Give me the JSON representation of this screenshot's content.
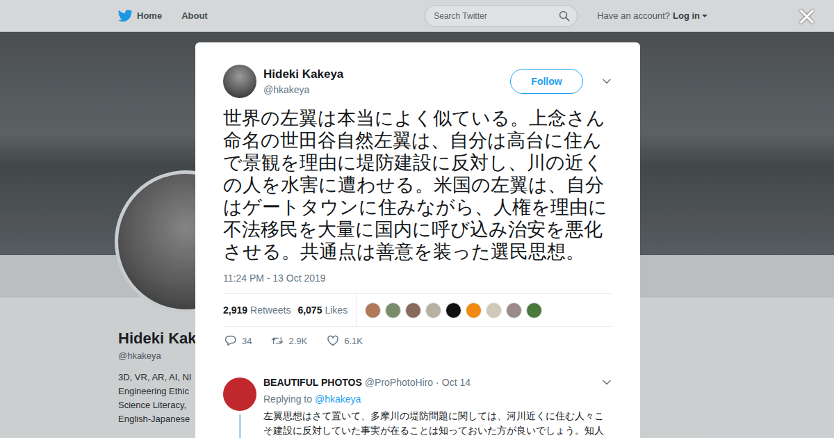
{
  "nav": {
    "items": [
      "Home",
      "About"
    ],
    "search": {
      "placeholder": "Search Twitter"
    },
    "account_prompt": "Have an account?",
    "login": "Log in"
  },
  "close": "×",
  "profile": {
    "name": "Hideki Kake",
    "handle": "@hkakeya",
    "bio_lines": [
      "3D, VR, AR, AI, NI",
      "Engineering Ethic",
      "Science Literacy,",
      "English-Japanese"
    ]
  },
  "tweet": {
    "author": "Hideki Kakeya",
    "handle": "@hkakeya",
    "follow": "Follow",
    "text": "世界の左翼は本当によく似ている。上念さん命名の世田谷自然左翼は、自分は高台に住んで景観を理由に堤防建設に反対し、川の近くの人を水害に遭わせる。米国の左翼は、自分はゲートタウンに住みながら、人権を理由に不法移民を大量に国内に呼び込み治安を悪化させる。共通点は善意を装った選民思想。",
    "timestamp": "11:24 PM - 13 Oct 2019",
    "retweets_count": "2,919",
    "retweets_label": "Retweets",
    "likes_count": "6,075",
    "likes_label": "Likes",
    "liker_avatars": [
      {
        "color": "#b07a5a"
      },
      {
        "color": "#7a8c6a"
      },
      {
        "color": "#8a6a5a"
      },
      {
        "color": "#b8b0a0"
      },
      {
        "color": "#111111"
      },
      {
        "color": "#f08a10"
      },
      {
        "color": "#d0c8b8"
      },
      {
        "color": "#9a8a8a"
      },
      {
        "color": "#4a7a3a"
      }
    ],
    "actions": [
      {
        "kind": "reply",
        "count": "34"
      },
      {
        "kind": "retweet",
        "count": "2.9K"
      },
      {
        "kind": "like",
        "count": "6.1K"
      }
    ]
  },
  "replies": [
    {
      "name": "BEAUTIFUL PHOTOS",
      "handle": "@ProPhotoHiro",
      "separator": "·",
      "time": "Oct 14",
      "replying_label": "Replying to",
      "replying_to": "@hkakeya",
      "color": "#c0282d",
      "text": "左翼思想はさて置いて、多摩川の堤防問題に関しては、河川近くに住む人々こそ建設に反対していた事実が在ることは知っておいた方が良いでしょう。知人"
    }
  ]
}
